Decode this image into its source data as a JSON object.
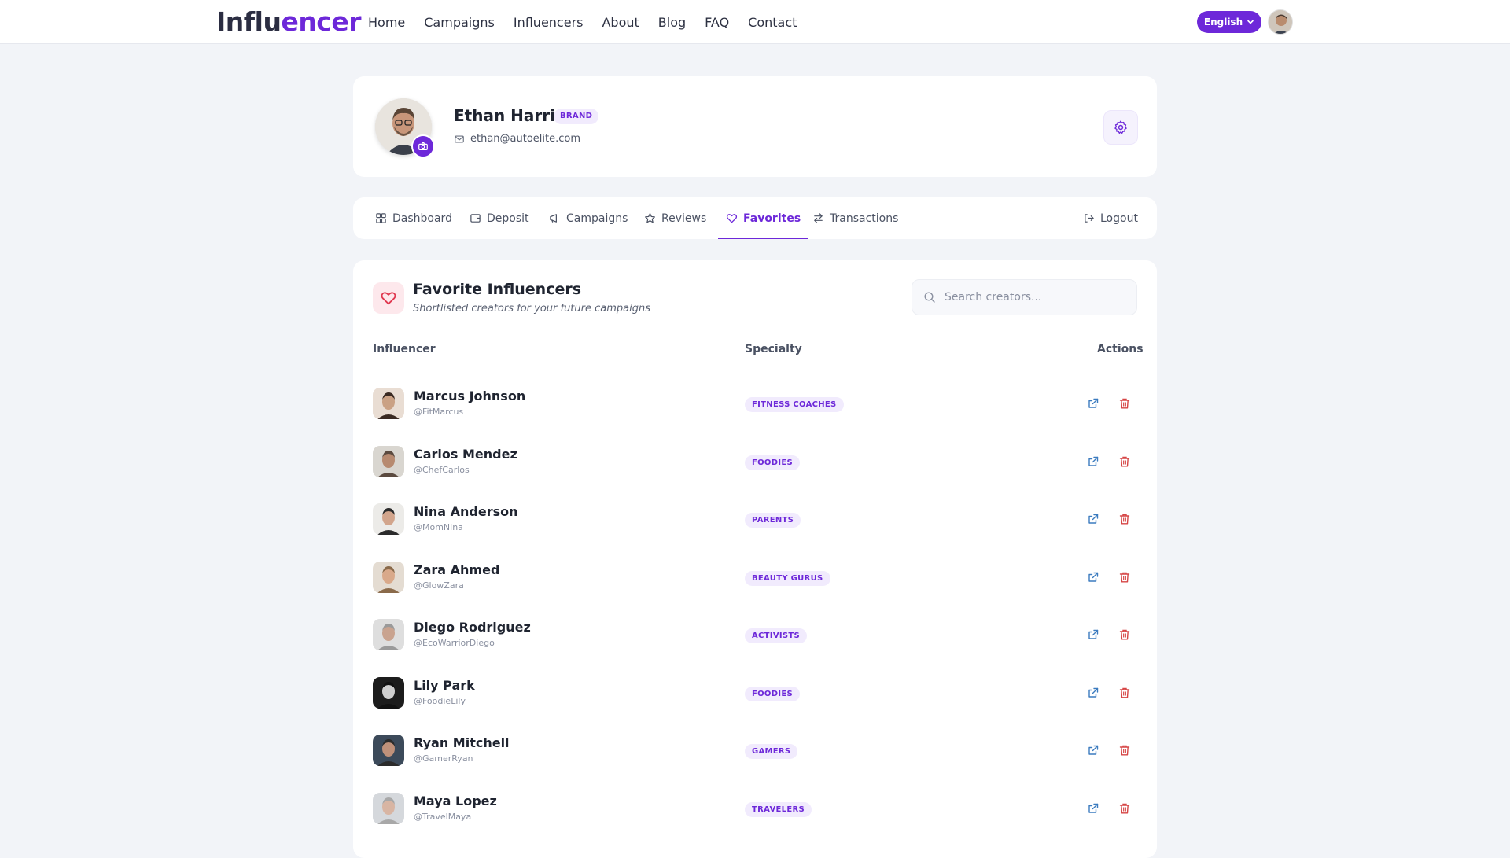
{
  "brand": {
    "logo_part1": "Influ",
    "logo_part2": "encer",
    "accent": "#6d28d9"
  },
  "nav": [
    "Home",
    "Campaigns",
    "Influencers",
    "About",
    "Blog",
    "FAQ",
    "Contact"
  ],
  "language": {
    "selected": "English"
  },
  "profile": {
    "name": "Ethan Harris",
    "role_badge": "BRAND",
    "email": "ethan@autoelite.com"
  },
  "tabs": [
    {
      "label": "Dashboard",
      "icon": "grid-icon"
    },
    {
      "label": "Deposit",
      "icon": "wallet-icon"
    },
    {
      "label": "Campaigns",
      "icon": "megaphone-icon"
    },
    {
      "label": "Reviews",
      "icon": "star-icon"
    },
    {
      "label": "Favorites",
      "icon": "heart-icon",
      "active": true
    },
    {
      "label": "Transactions",
      "icon": "arrows-icon"
    }
  ],
  "logout_label": "Logout",
  "favorites": {
    "title": "Favorite Influencers",
    "subtitle": "Shortlisted creators for your future campaigns",
    "search_placeholder": "Search creators...",
    "columns": {
      "influencer": "Influencer",
      "specialty": "Specialty",
      "actions": "Actions"
    },
    "rows": [
      {
        "name": "Marcus Johnson",
        "handle": "@FitMarcus",
        "specialty": "FITNESS COACHES"
      },
      {
        "name": "Carlos Mendez",
        "handle": "@ChefCarlos",
        "specialty": "FOODIES"
      },
      {
        "name": "Nina Anderson",
        "handle": "@MomNina",
        "specialty": "PARENTS"
      },
      {
        "name": "Zara Ahmed",
        "handle": "@GlowZara",
        "specialty": "BEAUTY GURUS"
      },
      {
        "name": "Diego Rodriguez",
        "handle": "@EcoWarriorDiego",
        "specialty": "ACTIVISTS"
      },
      {
        "name": "Lily Park",
        "handle": "@FoodieLily",
        "specialty": "FOODIES"
      },
      {
        "name": "Ryan Mitchell",
        "handle": "@GamerRyan",
        "specialty": "GAMERS"
      },
      {
        "name": "Maya Lopez",
        "handle": "@TravelMaya",
        "specialty": "TRAVELERS"
      }
    ]
  }
}
